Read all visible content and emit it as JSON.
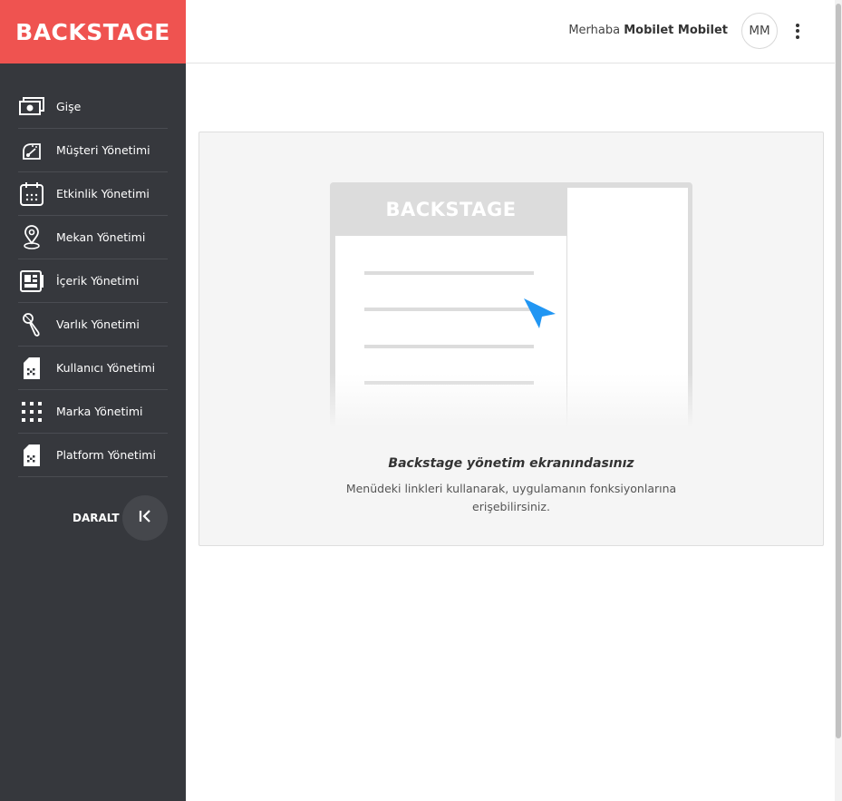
{
  "brand": {
    "logo_text": "BACKSTAGE",
    "color": "#ef5350"
  },
  "sidebar": {
    "items": [
      {
        "label": "Gişe",
        "icon": "money-icon"
      },
      {
        "label": "Müşteri Yönetimi",
        "icon": "gauge-icon"
      },
      {
        "label": "Etkinlik Yönetimi",
        "icon": "calendar-icon"
      },
      {
        "label": "Mekan Yönetimi",
        "icon": "map-pin-icon"
      },
      {
        "label": "İçerik Yönetimi",
        "icon": "content-icon"
      },
      {
        "label": "Varlık Yönetimi",
        "icon": "microphone-icon"
      },
      {
        "label": "Kullanıcı Yönetimi",
        "icon": "sim-card-icon"
      },
      {
        "label": "Marka Yönetimi",
        "icon": "grid-icon"
      },
      {
        "label": "Platform Yönetimi",
        "icon": "sim-card-icon"
      }
    ],
    "collapse_label": "DARALT"
  },
  "header": {
    "greeting_prefix": "Merhaba",
    "user_name": "Mobilet Mobilet",
    "avatar_initials": "MM"
  },
  "main": {
    "illustration_logo": "BACKSTAGE",
    "title": "Backstage yönetim ekranındasınız",
    "subtitle_line1": "Menüdeki linkleri kullanarak, uygulamanın fonksiyonlarına",
    "subtitle_line2": "erişebilirsiniz."
  },
  "colors": {
    "sidebar_bg": "#36383d",
    "accent": "#ef5350",
    "pointer": "#2196f3"
  }
}
